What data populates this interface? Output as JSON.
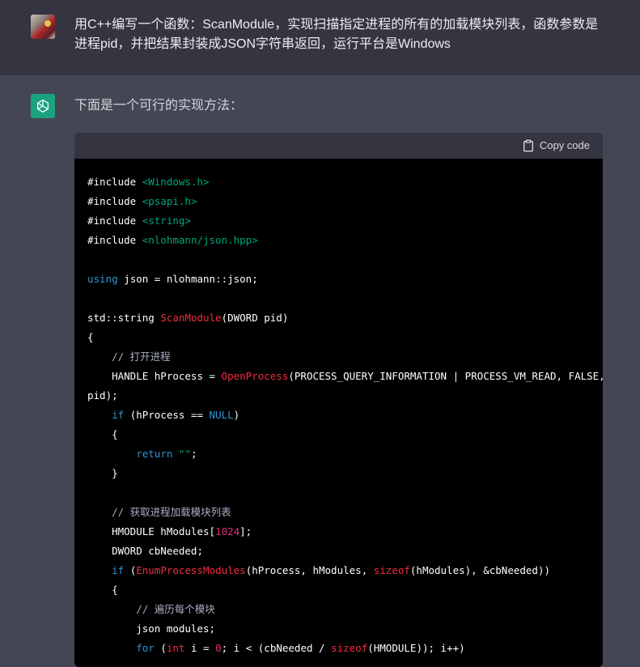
{
  "user": {
    "message": "用C++编写一个函数：ScanModule，实现扫描指定进程的所有的加载模块列表，函数参数是进程pid，并把结果封装成JSON字符串返回，运行平台是Windows"
  },
  "assistant": {
    "intro": "下面是一个可行的实现方法：",
    "copy_label": "Copy code",
    "code": {
      "l1_inc": "#include ",
      "l1_hdr": "<Windows.h>",
      "l2_inc": "#include ",
      "l2_hdr": "<psapi.h>",
      "l3_inc": "#include ",
      "l3_hdr": "<string>",
      "l4_inc": "#include ",
      "l4_hdr": "<nlohmann/json.hpp>",
      "l6_using": "using",
      "l6_rest": " json = nlohmann::json;",
      "l8_a": "std::string ",
      "l8_fn": "ScanModule",
      "l8_b": "(DWORD pid)",
      "l9": "{",
      "l10_cm": "    // 打开进程",
      "l11_a": "    HANDLE hProcess = ",
      "l11_fn": "OpenProcess",
      "l11_b": "(PROCESS_QUERY_INFORMATION | PROCESS_VM_READ, FALSE,",
      "l12": "pid);",
      "l13_ind": "    ",
      "l13_if": "if",
      "l13_a": " (hProcess == ",
      "l13_null": "NULL",
      "l13_b": ")",
      "l14": "    {",
      "l15_ind": "        ",
      "l15_ret": "return",
      "l15_sp": " ",
      "l15_str": "\"\"",
      "l15_end": ";",
      "l16": "    }",
      "l18_cm": "    // 获取进程加载模块列表",
      "l19_a": "    HMODULE hModules[",
      "l19_num": "1024",
      "l19_b": "];",
      "l20": "    DWORD cbNeeded;",
      "l21_ind": "    ",
      "l21_if": "if",
      "l21_a": " (",
      "l21_fn": "EnumProcessModules",
      "l21_b": "(hProcess, hModules, ",
      "l21_sz": "sizeof",
      "l21_c": "(hModules), &cbNeeded))",
      "l22": "    {",
      "l23_cm": "        // 遍历每个模块",
      "l24": "        json modules;",
      "l25_ind": "        ",
      "l25_for": "for",
      "l25_a": " (",
      "l25_int": "int",
      "l25_b": " i = ",
      "l25_zero": "0",
      "l25_c": "; i < (cbNeeded / ",
      "l25_sz": "sizeof",
      "l25_d": "(HMODULE)); i++)"
    }
  }
}
